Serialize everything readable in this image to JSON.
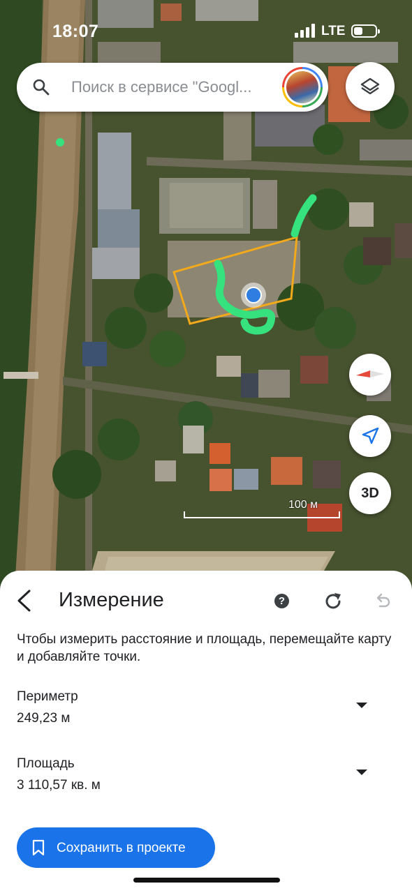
{
  "status_bar": {
    "time": "18:07",
    "network": "LTE"
  },
  "search": {
    "placeholder": "Поиск в сервисе \"Googl...",
    "icon": "search-icon"
  },
  "map": {
    "scale_label": "100 м",
    "three_d_label": "3D",
    "measure_outline_color": "#f2a91c",
    "drawn_line_color": "#35e27e",
    "location_dot_color": "#2f7de1"
  },
  "sheet": {
    "title": "Измерение",
    "help_label": "?",
    "description": "Чтобы измерить расстояние и площадь, перемещайте карту и добавляйте точки.",
    "perimeter": {
      "label": "Периметр",
      "value": "249,23 м"
    },
    "area": {
      "label": "Площадь",
      "value": "3 110,57 кв. м"
    },
    "save_button": "Сохранить в проекте",
    "accent_color": "#1a73e8"
  }
}
